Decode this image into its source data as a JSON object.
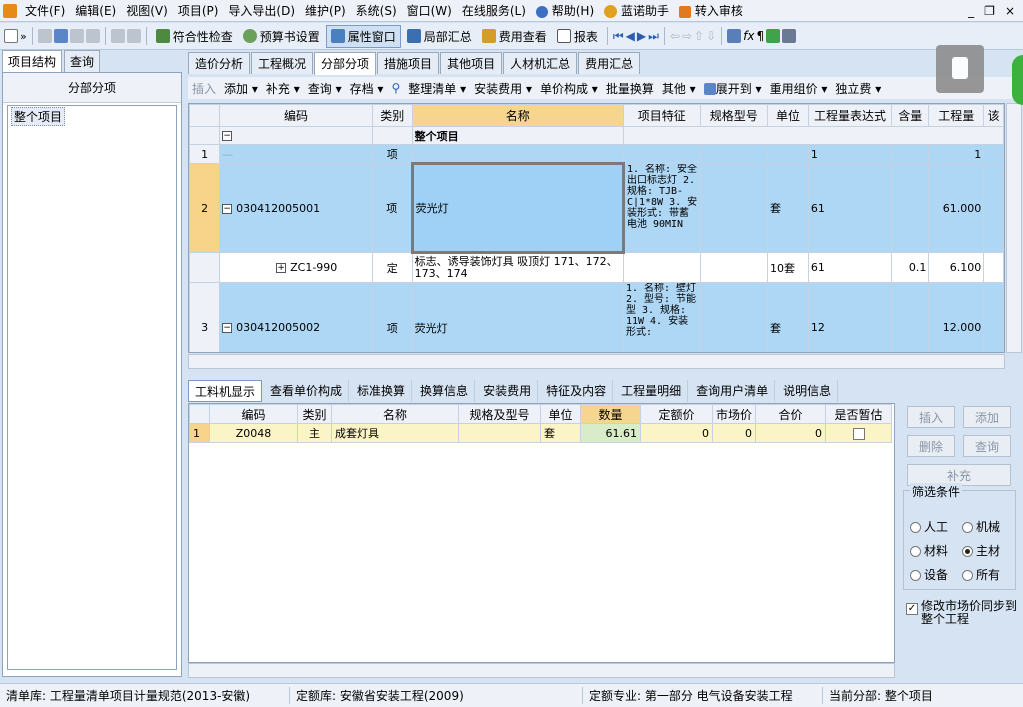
{
  "menu": {
    "items": [
      "文件(F)",
      "编辑(E)",
      "视图(V)",
      "项目(P)",
      "导入导出(D)",
      "维护(P)",
      "系统(S)",
      "窗口(W)",
      "在线服务(L)",
      "帮助(H)",
      "蓝诺助手",
      "转入审核"
    ],
    "window_controls": [
      "_",
      "❐",
      "×"
    ]
  },
  "toolbar": {
    "compliance_check": "符合性检查",
    "budget_settings": "预算书设置",
    "property_window": "属性窗口",
    "local_summary": "局部汇总",
    "cost_view": "费用查看",
    "report": "报表"
  },
  "left": {
    "tabs": [
      "项目结构",
      "查询"
    ],
    "header": "分部分项",
    "tree_root": "整个项目"
  },
  "main_tabs": [
    "造价分析",
    "工程概况",
    "分部分项",
    "措施项目",
    "其他项目",
    "人材机汇总",
    "费用汇总"
  ],
  "toolbar2": {
    "insert": "插入",
    "add": "添加",
    "supplement": "补充",
    "query": "查询",
    "archive": "存档",
    "organize": "整理清单",
    "install_fee": "安装费用",
    "unit_price": "单价构成",
    "batch_convert": "批量换算",
    "other": "其他",
    "expand": "展开到",
    "reuse": "重用组价",
    "independent_fee": "独立费"
  },
  "grid": {
    "headers": [
      "编码",
      "类别",
      "名称",
      "项目特征",
      "规格型号",
      "单位",
      "工程量表达式",
      "含量",
      "工程量",
      "该"
    ],
    "group_title": "整个项目",
    "rows": [
      {
        "num": "1",
        "code": "",
        "type": "项",
        "name": "",
        "feature": "",
        "unit": "",
        "expr": "1",
        "content": "",
        "qty": "1"
      },
      {
        "num": "2",
        "code": "030412005001",
        "type": "项",
        "name": "荧光灯",
        "feature": "1. 名称: 安全出口标志灯 2. 规格: TJB-C|1*8W 3. 安装形式: 带蓄电池 90MIN",
        "unit": "套",
        "expr": "61",
        "content": "",
        "qty": "61.000"
      },
      {
        "num": "",
        "code": "ZC1-990",
        "type": "定",
        "name": "标志、诱导装饰灯具 吸顶灯 171、172、173、174",
        "feature": "",
        "unit": "10套",
        "expr": "61",
        "content": "0.1",
        "qty": "6.100"
      },
      {
        "num": "3",
        "code": "030412005002",
        "type": "项",
        "name": "荧光灯",
        "feature": "1. 名称: 壁灯 2. 型号: 节能型 3. 规格: 11W 4. 安装形式:",
        "unit": "套",
        "expr": "12",
        "content": "",
        "qty": "12.000"
      }
    ]
  },
  "bottom_tabs": [
    "工料机显示",
    "查看单价构成",
    "标准换算",
    "换算信息",
    "安装费用",
    "特征及内容",
    "工程量明细",
    "查询用户清单",
    "说明信息"
  ],
  "bgrid": {
    "headers": [
      "编码",
      "类别",
      "名称",
      "规格及型号",
      "单位",
      "数量",
      "定额价",
      "市场价",
      "合价",
      "是否暂估"
    ],
    "rows": [
      {
        "num": "1",
        "code": "Z0048",
        "type": "主",
        "name": "成套灯具",
        "spec": "",
        "unit": "套",
        "qty": "61.61",
        "quota": "0",
        "market": "0",
        "total": "0"
      }
    ]
  },
  "side": {
    "insert": "插入",
    "add": "添加",
    "delete": "删除",
    "query": "查询",
    "supplement": "补充",
    "filter_title": "筛选条件",
    "filters": [
      "人工",
      "机械",
      "材料",
      "主材",
      "设备",
      "所有"
    ],
    "sync_label": "修改市场价同步到整个工程"
  },
  "status": {
    "list_lib": "清单库: 工程量清单项目计量规范(2013-安徽)",
    "quota_lib": "定额库: 安徽省安装工程(2009)",
    "quota_major": "定额专业: 第一部分  电气设备安装工程",
    "current": "当前分部: 整个项目"
  },
  "colors": {
    "accent": "#aed6f5",
    "header_highlight": "#f6d68e",
    "selected_row": "#f7d48a"
  }
}
